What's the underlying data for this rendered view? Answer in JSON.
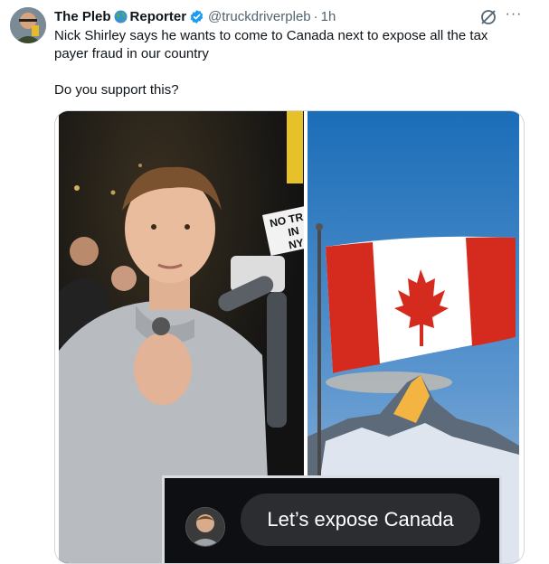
{
  "tweet": {
    "display_name_part1": "The Pleb",
    "display_name_part2": "Reporter",
    "handle": "@truckdriverpleb",
    "separator": "·",
    "time": "1h",
    "text_line1": "Nick Shirley says he wants to come to Canada next to expose all the tax payer fraud in our country",
    "text_line2": "Do you support this?",
    "more_label": "···",
    "icons": {
      "globe": "globe-icon",
      "verified": "verified-badge-icon",
      "grok": "grok-icon",
      "more": "more-icon"
    }
  },
  "media": {
    "sign_text_lines": [
      "NO TR",
      "IN",
      "NY"
    ],
    "caption_bubble": "Let’s expose Canada"
  },
  "colors": {
    "verified_blue": "#1d9bf0",
    "secondary_text": "#536471",
    "canada_red": "#d52b1e"
  }
}
